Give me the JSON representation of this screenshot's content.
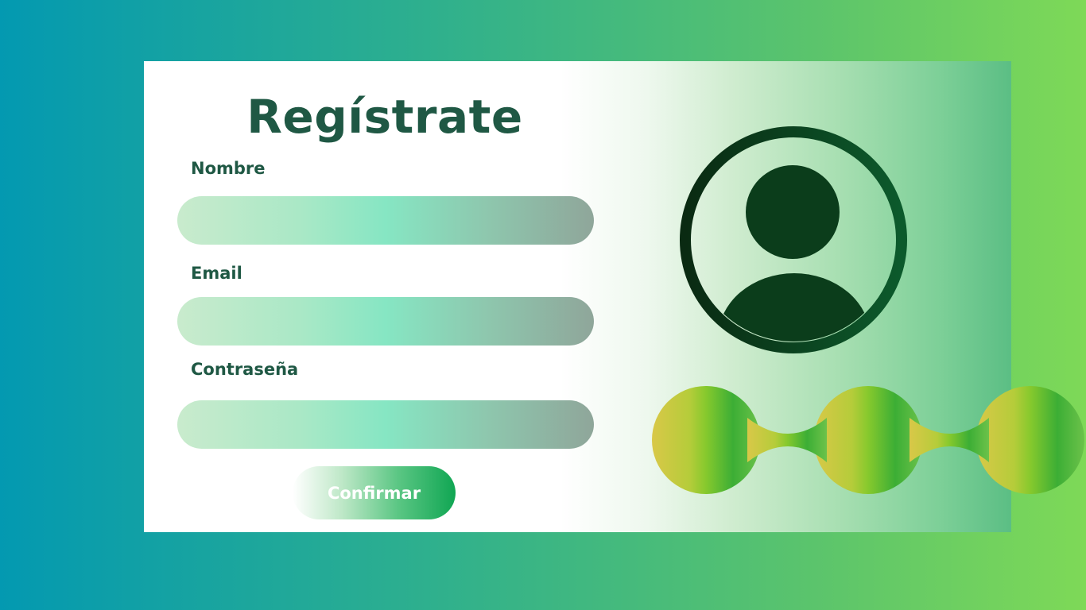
{
  "form": {
    "title": "Regístrate",
    "fields": [
      {
        "label": "Nombre",
        "value": "",
        "placeholder": ""
      },
      {
        "label": "Email",
        "value": "",
        "placeholder": ""
      },
      {
        "label": "Contraseña",
        "value": "",
        "placeholder": ""
      }
    ],
    "submit_label": "Confirmar"
  },
  "decorations": {
    "avatar_icon": "user-avatar-icon",
    "blob_strip": "connected-circles-decoration"
  },
  "colors": {
    "title_text": "#1f5844",
    "avatar_dark": "#0b3d1e",
    "button_green": "#10a653",
    "background_start": "#0399b1",
    "background_end": "#7ed957"
  }
}
